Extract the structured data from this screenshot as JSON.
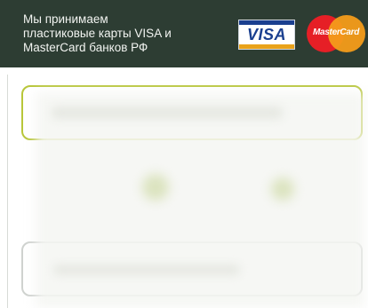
{
  "header": {
    "lines": [
      "Мы принимаем",
      "пластиковые карты VISA и",
      "MasterCard банков РФ"
    ],
    "background": "#2d3d33"
  },
  "logos": {
    "visa_label": "VISA",
    "mastercard_label": "MasterCard"
  },
  "form": {
    "accent_border": "#b8c63a"
  }
}
